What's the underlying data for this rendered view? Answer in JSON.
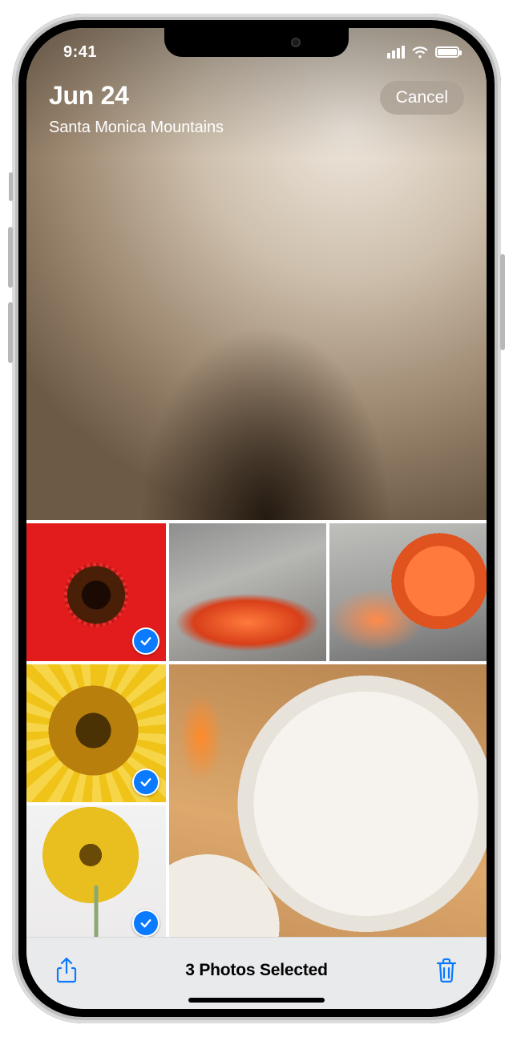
{
  "status": {
    "time": "9:41"
  },
  "header": {
    "date": "Jun 24",
    "location": "Santa Monica Mountains",
    "cancel_label": "Cancel"
  },
  "photos": [
    {
      "name": "red-flower",
      "selected": true
    },
    {
      "name": "citrus-slice",
      "selected": false
    },
    {
      "name": "grapefruit",
      "selected": false
    },
    {
      "name": "yellow-flower",
      "selected": true
    },
    {
      "name": "food-plate",
      "selected": false
    },
    {
      "name": "yellow-daisy",
      "selected": true
    }
  ],
  "toolbar": {
    "status_label": "3 Photos Selected"
  },
  "colors": {
    "accent": "#0a7aff"
  }
}
